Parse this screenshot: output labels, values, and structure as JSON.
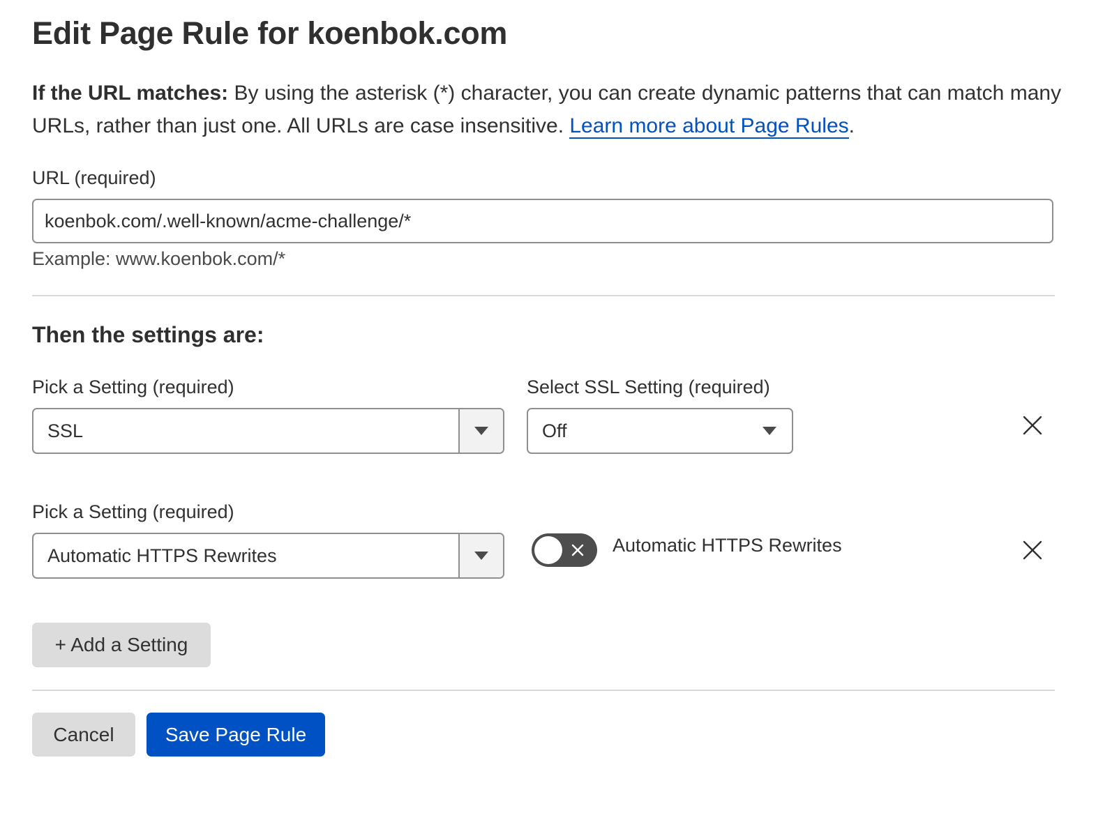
{
  "page": {
    "title": "Edit Page Rule for koenbok.com"
  },
  "intro": {
    "bold_lead": "If the URL matches:",
    "text": " By using the asterisk (*) character, you can create dynamic patterns that can match many URLs, rather than just one. All URLs are case insensitive. ",
    "link_label": "Learn more about Page Rules",
    "trailing": "."
  },
  "url_field": {
    "label": "URL (required)",
    "value": "koenbok.com/.well-known/acme-challenge/*",
    "example": "Example: www.koenbok.com/*"
  },
  "settings": {
    "heading": "Then the settings are:",
    "rows": [
      {
        "pick_label": "Pick a Setting (required)",
        "pick_value": "SSL",
        "option_label": "Select SSL Setting (required)",
        "option_value": "Off"
      },
      {
        "pick_label": "Pick a Setting (required)",
        "pick_value": "Automatic HTTPS Rewrites",
        "toggle_label": "Automatic HTTPS Rewrites",
        "toggle_on": false
      }
    ],
    "add_button_label": "+ Add a Setting"
  },
  "actions": {
    "cancel_label": "Cancel",
    "save_label": "Save Page Rule"
  },
  "colors": {
    "primary": "#0051c3",
    "link": "#0051c3",
    "toggle_off": "#4d4d4d",
    "secondary_button": "#dcdcdc"
  },
  "icons": {
    "remove": "close-icon",
    "dropdown": "caret-down-icon",
    "toggle_off": "x-icon"
  }
}
